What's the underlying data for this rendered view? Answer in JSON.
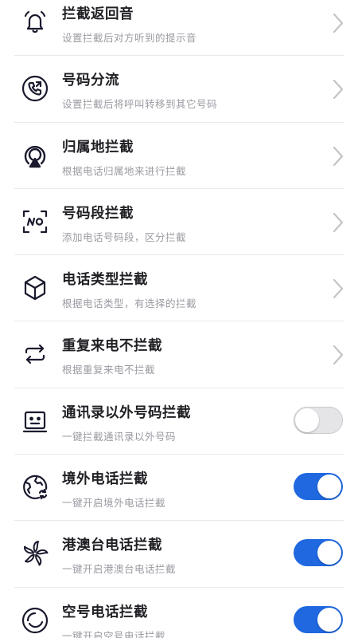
{
  "settings": {
    "items": [
      {
        "title": "拦截返回音",
        "subtitle": "设置拦截后对方听到的提示音",
        "icon": "bell-icon",
        "control": "chevron"
      },
      {
        "title": "号码分流",
        "subtitle": "设置拦截后将呼叫转移到其它号码",
        "icon": "call-forward-icon",
        "control": "chevron"
      },
      {
        "title": "归属地拦截",
        "subtitle": "根据电话归属地来进行拦截",
        "icon": "location-icon",
        "control": "chevron"
      },
      {
        "title": "号码段拦截",
        "subtitle": "添加电话号码段，区分拦截",
        "icon": "number-scan-icon",
        "control": "chevron"
      },
      {
        "title": "电话类型拦截",
        "subtitle": "根据电话类型，有选择的拦截",
        "icon": "cube-icon",
        "control": "chevron"
      },
      {
        "title": "重复来电不拦截",
        "subtitle": "根据重复来电不拦截",
        "icon": "repeat-icon",
        "control": "chevron"
      },
      {
        "title": "通讯录以外号码拦截",
        "subtitle": "一键拦截通讯录以外号码",
        "icon": "contact-card-icon",
        "control": "toggle",
        "enabled": false
      },
      {
        "title": "境外电话拦截",
        "subtitle": "一键开启境外电话拦截",
        "icon": "globe-icon",
        "control": "toggle",
        "enabled": true
      },
      {
        "title": "港澳台电话拦截",
        "subtitle": "一键开启港澳台电话拦截",
        "icon": "bauhinia-icon",
        "control": "toggle",
        "enabled": true
      },
      {
        "title": "空号电话拦截",
        "subtitle": "一键开启空号电话拦截",
        "icon": "empty-circle-icon",
        "control": "toggle",
        "enabled": true
      }
    ]
  },
  "colors": {
    "toggle_on": "#1f68e0",
    "toggle_off": "#e5e5e8",
    "title": "#1f1f24",
    "subtitle": "#9a9aa2",
    "icon": "#1a1a2e"
  }
}
